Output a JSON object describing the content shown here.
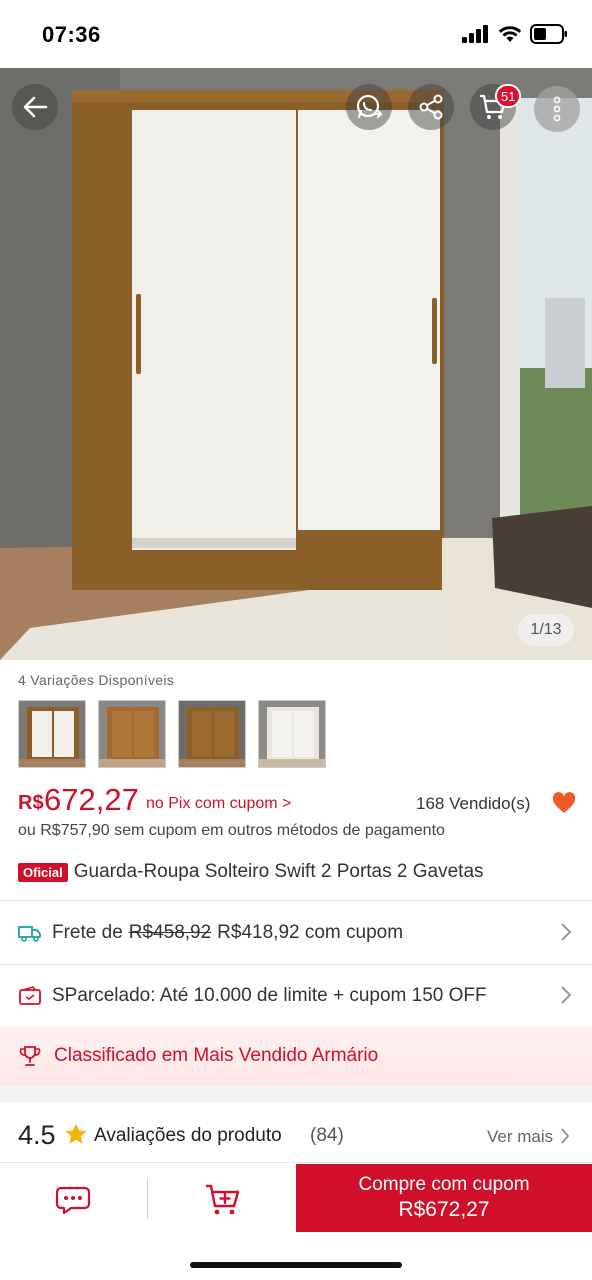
{
  "status_bar": {
    "time": "07:36"
  },
  "gallery": {
    "counter": "1/13",
    "cart_badge": "51",
    "icons": [
      "back-arrow-icon",
      "whatsapp-share-icon",
      "share-icon",
      "cart-icon",
      "more-vertical-icon"
    ]
  },
  "variations": {
    "label": "4 Variações Disponíveis",
    "count": 4
  },
  "price": {
    "currency": "R$",
    "value": "672,27",
    "pix_text": "no Pix com cupom >",
    "sold": "168 Vendido(s)",
    "alt_text": "ou R$757,90 sem cupom em outros métodos de pagamento"
  },
  "product": {
    "badge": "Oficial",
    "title": "Guarda-Roupa Solteiro Swift 2 Portas 2 Gavetas"
  },
  "shipping": {
    "label": "Frete de",
    "old_price": "R$458,92",
    "new_price": "R$418,92 com cupom"
  },
  "installments": {
    "text": "SParcelado: Até 10.000 de limite + cupom 150 OFF"
  },
  "ranking": {
    "text": "Classificado em Mais Vendido Armário"
  },
  "reviews": {
    "rating": "4.5",
    "label": "Avaliações do produto",
    "count": "(84)",
    "more": "Ver mais"
  },
  "bottom_bar": {
    "buy_label": "Compre com cupom",
    "buy_price": "R$672,27"
  },
  "colors": {
    "accent": "#d0102a",
    "heart": "#ee5a2a",
    "star": "#f5b400"
  }
}
